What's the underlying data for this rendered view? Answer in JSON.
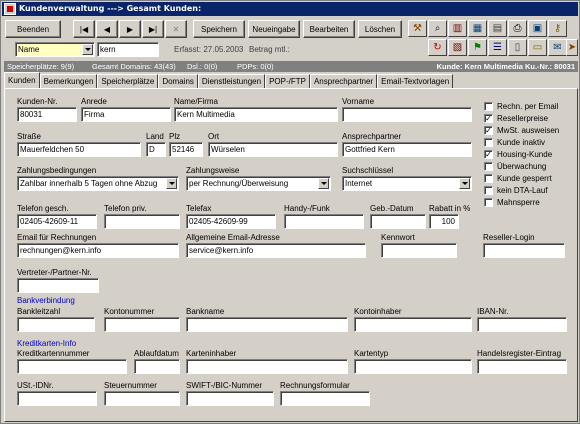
{
  "window": {
    "title": "Kundenverwaltung    ---> Gesamt Kunden:"
  },
  "toolbar": {
    "beenden": "Beenden",
    "nav_first": "|◀",
    "nav_prev": "◀",
    "nav_next": "▶",
    "nav_last": "▶|",
    "nav_delete": "✕",
    "speichern": "Speichern",
    "neueingabe": "Neueingabe",
    "bearbeiten": "Bearbeiten",
    "loeschen": "Löschen"
  },
  "search": {
    "field_select": "Name",
    "value": "kern",
    "erfasst": "Erfasst: 27.05.2003",
    "betrag": "Betrag mtl.:"
  },
  "status": {
    "speicherplaetze": "Speicherplätze: 9(9)",
    "domains": "Gesamt Domains: 43(43)",
    "dsl": "Dsl.: 0(0)",
    "pdps": "PDPs: 0(0)",
    "kunde": "Kunde: Kern Multimedia Ku.-Nr.: 80031"
  },
  "tabs": [
    "Kunden",
    "Bemerkungen",
    "Speicherplätze",
    "Domains",
    "Dienstleistungen",
    "POP-/FTP",
    "Ansprechpartner",
    "Email-Textvorlagen"
  ],
  "form": {
    "kundennr": {
      "label": "Kunden-Nr.",
      "value": "80031"
    },
    "anrede": {
      "label": "Anrede",
      "value": "Firma"
    },
    "name": {
      "label": "Name/Firma",
      "value": "Kern Multimedia"
    },
    "vorname": {
      "label": "Vorname",
      "value": ""
    },
    "strasse": {
      "label": "Straße",
      "value": "Mauerfeldchen 50"
    },
    "land": {
      "label": "Land",
      "value": "D"
    },
    "plz": {
      "label": "Plz",
      "value": "52146"
    },
    "ort": {
      "label": "Ort",
      "value": "Würselen"
    },
    "ansprechpartner": {
      "label": "Ansprechpartner",
      "value": "Gottfried Kern"
    },
    "zahlungsbedingungen": {
      "label": "Zahlungsbedingungen",
      "value": "Zahlbar innerhalb 5 Tagen ohne Abzug"
    },
    "zahlungsweise": {
      "label": "Zahlungsweise",
      "value": "per Rechnung/Überweisung"
    },
    "suchschluessel": {
      "label": "Suchschlüssel",
      "value": "Internet"
    },
    "telefon": {
      "label": "Telefon gesch.",
      "value": "02405-42609-11"
    },
    "telefon_priv": {
      "label": "Telefon priv.",
      "value": ""
    },
    "telefax": {
      "label": "Telefax",
      "value": "02405-42609-99"
    },
    "handy": {
      "label": "Handy-/Funk",
      "value": ""
    },
    "geb_datum": {
      "label": "Geb.-Datum",
      "value": ""
    },
    "rabatt": {
      "label": "Rabatt in %",
      "value": "100"
    },
    "email_rechnungen": {
      "label": "Email für Rechnungen",
      "value": "rechnungen@kern.info"
    },
    "email_allgemein": {
      "label": "Allgemeine Email-Adresse",
      "value": "service@kern.info"
    },
    "kennwort": {
      "label": "Kennwort",
      "value": ""
    },
    "reseller_login": {
      "label": "Reseller-Login",
      "value": ""
    },
    "vertreter": {
      "label": "Vertreter-/Partner-Nr.",
      "value": ""
    }
  },
  "checkboxes": [
    {
      "label": "Rechn. per Email",
      "checked": false
    },
    {
      "label": "Resellerpreise",
      "checked": true
    },
    {
      "label": "MwSt. ausweisen",
      "checked": true
    },
    {
      "label": "Kunde inaktiv",
      "checked": false
    },
    {
      "label": "Housing-Kunde",
      "checked": true
    },
    {
      "label": "Überwachung",
      "checked": false
    },
    {
      "label": "Kunde gesperrt",
      "checked": false
    },
    {
      "label": "kein DTA-Lauf",
      "checked": false
    },
    {
      "label": "Mahnsperre",
      "checked": false
    }
  ],
  "bank": {
    "section": "Bankverbindung",
    "blz": "Bankleitzahl",
    "kontonummer": "Kontonummer",
    "bankname": "Bankname",
    "kontoinhaber": "Kontoinhaber",
    "iban": "IBAN-Nr."
  },
  "kredit": {
    "section": "Kreditkarten-Info",
    "kartennummer": "Kreditkartennummer",
    "ablaufdatum": "Ablaufdatum",
    "karteninhaber": "Karteninhaber",
    "kartentyp": "Kartentyp",
    "handelsregister": "Handelsregister-Eintrag"
  },
  "misc": {
    "ustid": "USt.-IDNr.",
    "steuernummer": "Steuernummer",
    "swift": "SWIFT-/BIC-Nummer",
    "rechnungsformular": "Rechnungsformular"
  },
  "icons": {
    "row1": [
      "tools-icon",
      "search-icon",
      "chart-icon",
      "grid-icon",
      "trash-icon",
      "print-icon",
      "window-icon",
      "key-icon"
    ],
    "row2": [
      "refresh-icon",
      "chart2-icon",
      "tag-icon",
      "list-icon",
      "doc-icon",
      "card-icon",
      "mail-icon",
      "export-icon"
    ]
  }
}
